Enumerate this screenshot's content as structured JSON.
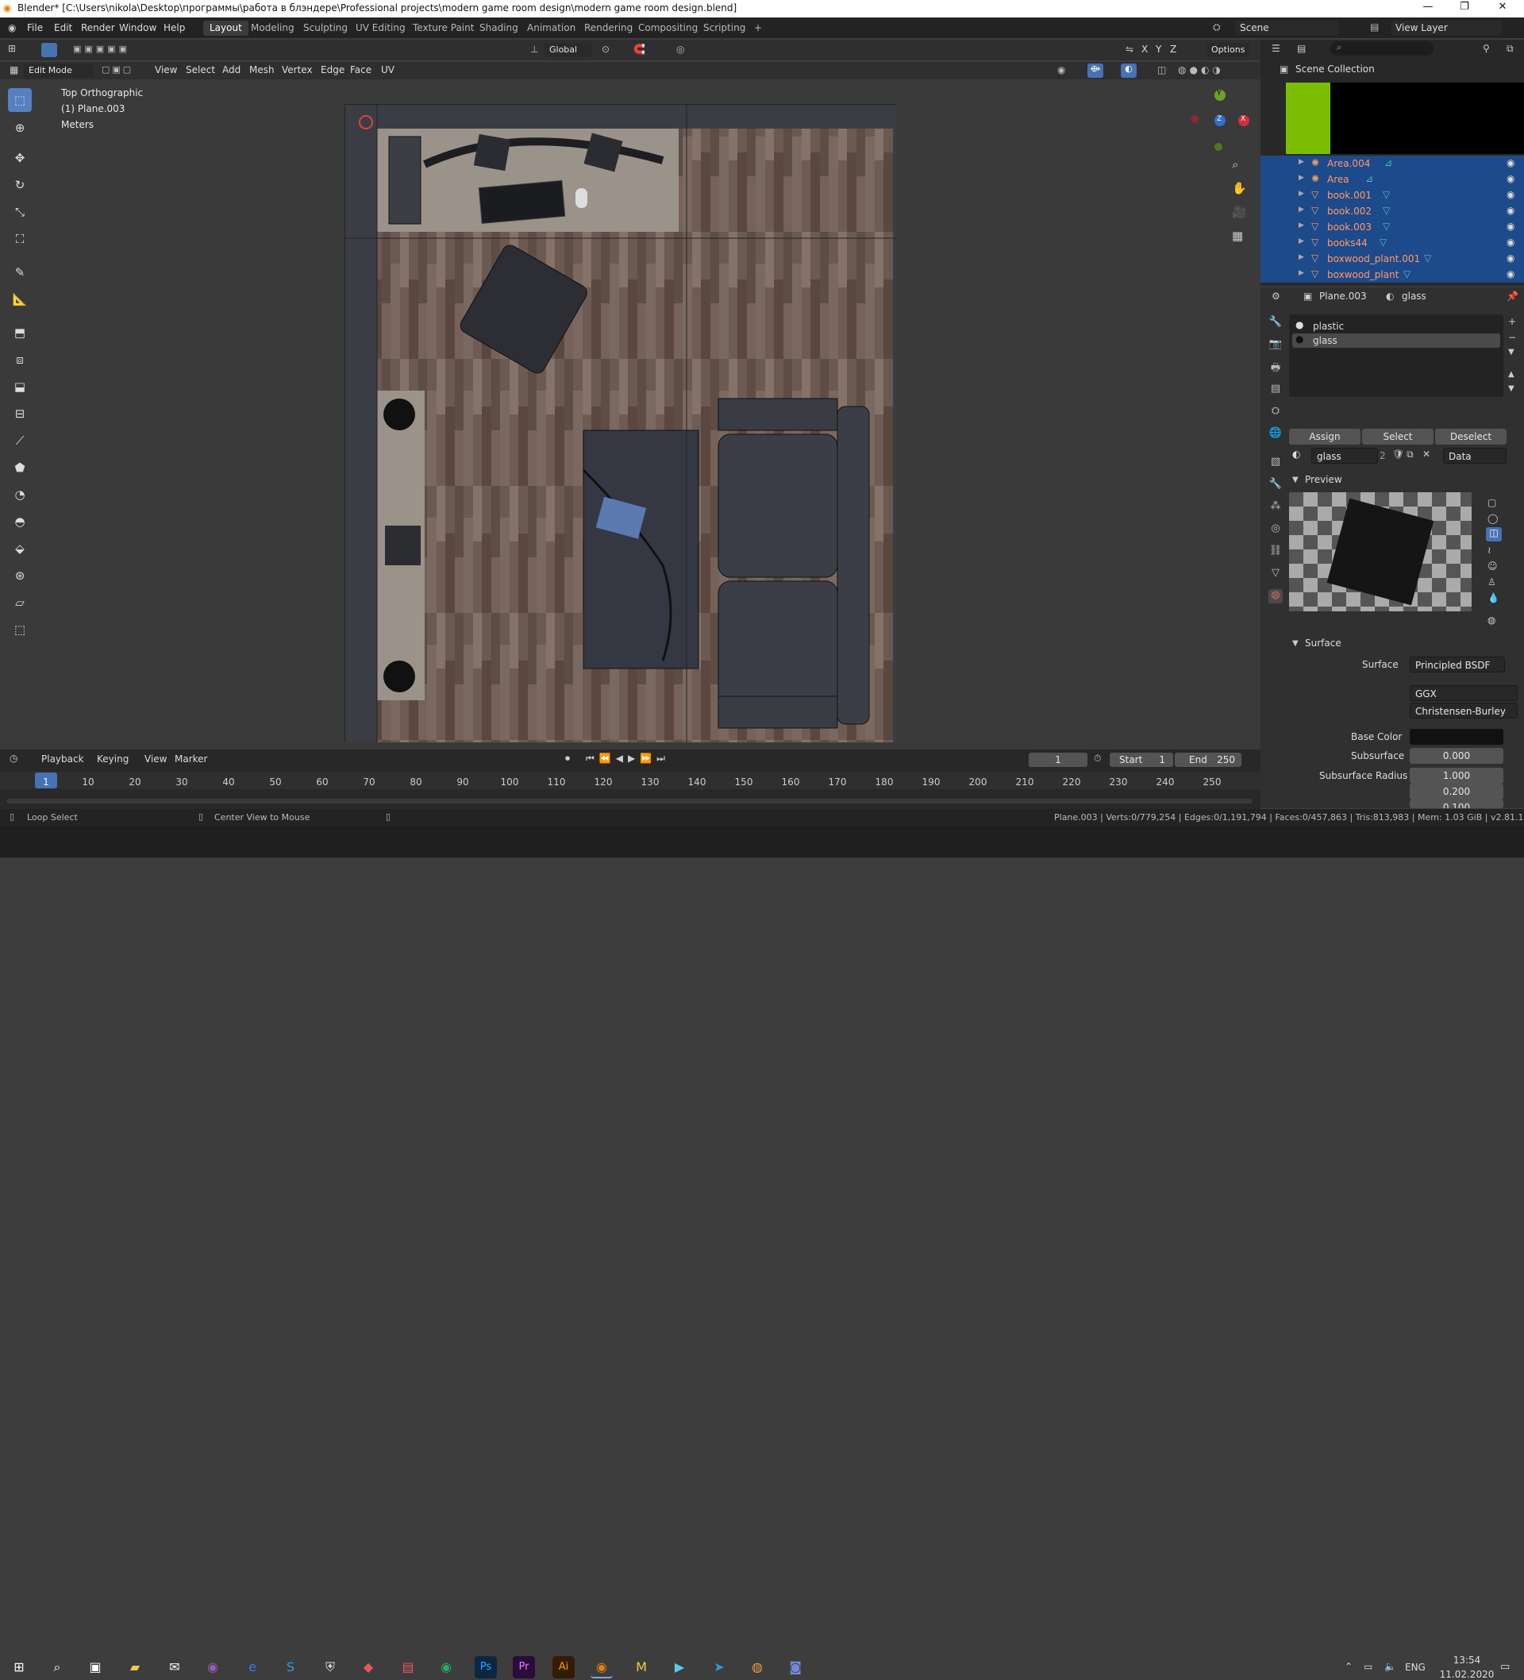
{
  "window": {
    "title": "Blender* [C:\\Users\\nikola\\Desktop\\программы\\работа в блэндере\\Professional projects\\modern game room design\\modern game room design.blend]",
    "min": "—",
    "max": "❐",
    "close": "✕"
  },
  "menu": {
    "file": "File",
    "edit": "Edit",
    "render": "Render",
    "window": "Window",
    "help": "Help"
  },
  "workspaces": [
    "Layout",
    "Modeling",
    "Sculpting",
    "UV Editing",
    "Texture Paint",
    "Shading",
    "Animation",
    "Rendering",
    "Compositing",
    "Scripting"
  ],
  "add_workspace": "+",
  "scene": {
    "label": "Scene",
    "view_layer": "View Layer"
  },
  "header3d": {
    "mode": "Edit Mode",
    "view": "View",
    "select": "Select",
    "add": "Add",
    "mesh": "Mesh",
    "vertex": "Vertex",
    "edge": "Edge",
    "face": "Face",
    "uv": "UV"
  },
  "tool_options": {
    "transform": "Global",
    "options": "Options",
    "x": "X",
    "y": "Y",
    "z": "Z"
  },
  "viewport_info": {
    "view": "Top Orthographic",
    "object": "(1) Plane.003",
    "units": "Meters"
  },
  "gizmo": {
    "y": "Y",
    "z": "Z",
    "x": "X"
  },
  "outliner": {
    "title": "Scene Collection",
    "items": [
      {
        "name": "Area.004",
        "type": "light"
      },
      {
        "name": "Area",
        "type": "light"
      },
      {
        "name": "book.001",
        "type": "mesh"
      },
      {
        "name": "book.002",
        "type": "mesh"
      },
      {
        "name": "book.003",
        "type": "mesh"
      },
      {
        "name": "books44",
        "type": "mesh"
      },
      {
        "name": "boxwood_plant.001",
        "type": "mesh"
      },
      {
        "name": "boxwood_plant",
        "type": "mesh"
      }
    ]
  },
  "properties": {
    "object": "Plane.003",
    "material": "glass",
    "slots": [
      "plastic",
      "glass"
    ],
    "assign": "Assign",
    "select": "Select",
    "deselect": "Deselect",
    "mat_name": "glass",
    "users": "2",
    "link": "Data",
    "preview_label": "Preview",
    "surface_label": "Surface",
    "surface_field": "Surface",
    "surface_value": "Principled BSDF",
    "distribution": "GGX",
    "subsurface_method": "Christensen-Burley",
    "base_color": "Base Color",
    "subsurface": "Subsurface",
    "subsurface_value": "0.000",
    "subsurface_radius": "Subsurface Radius",
    "radius": [
      "1.000",
      "0.200",
      "0.100"
    ]
  },
  "timeline": {
    "playback": "Playback",
    "keying": "Keying",
    "view": "View",
    "marker": "Marker",
    "current_frame": "1",
    "start_label": "Start",
    "start": "1",
    "end_label": "End",
    "end": "250",
    "ticks": [
      "1",
      "10",
      "20",
      "30",
      "40",
      "50",
      "60",
      "70",
      "80",
      "90",
      "100",
      "110",
      "120",
      "130",
      "140",
      "150",
      "160",
      "170",
      "180",
      "190",
      "200",
      "210",
      "220",
      "230",
      "240",
      "250"
    ]
  },
  "status": {
    "left": "Loop Select",
    "mid": "Center View to Mouse",
    "stats": "Plane.003 | Verts:0/779,254 | Edges:0/1,191,794 | Faces:0/457,863 | Tris:813,983 | Mem: 1.03 GiB | v2.81.16"
  },
  "taskbar": {
    "lang": "ENG",
    "time": "13:54",
    "date": "11.02.2020"
  }
}
